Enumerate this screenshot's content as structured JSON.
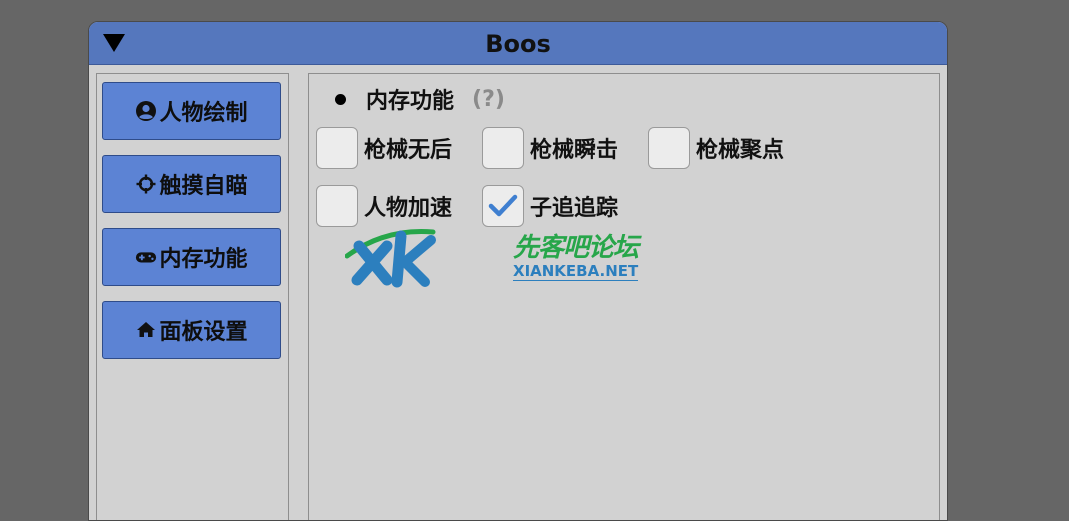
{
  "window": {
    "title": "Boos"
  },
  "sidebar": {
    "items": [
      {
        "label": "人物绘制",
        "icon": "user-circle-icon"
      },
      {
        "label": "触摸自瞄",
        "icon": "crosshair-icon"
      },
      {
        "label": "内存功能",
        "icon": "gamepad-icon"
      },
      {
        "label": "面板设置",
        "icon": "home-icon"
      }
    ]
  },
  "content": {
    "section_title": "内存功能",
    "help": "(?)",
    "checkboxes": [
      {
        "label": "枪械无后",
        "checked": false
      },
      {
        "label": "枪械瞬击",
        "checked": false
      },
      {
        "label": "枪械聚点",
        "checked": false
      },
      {
        "label": "人物加速",
        "checked": false
      },
      {
        "label": "子追追踪",
        "checked": true
      }
    ]
  },
  "watermark": {
    "name": "先客吧论坛",
    "domain": "XIANKEBA.NET"
  },
  "colors": {
    "titlebar": "#5577bd",
    "button": "#5c83d4",
    "panel": "#d2d2d2",
    "background": "#666666",
    "check": "#3f7fd0"
  }
}
